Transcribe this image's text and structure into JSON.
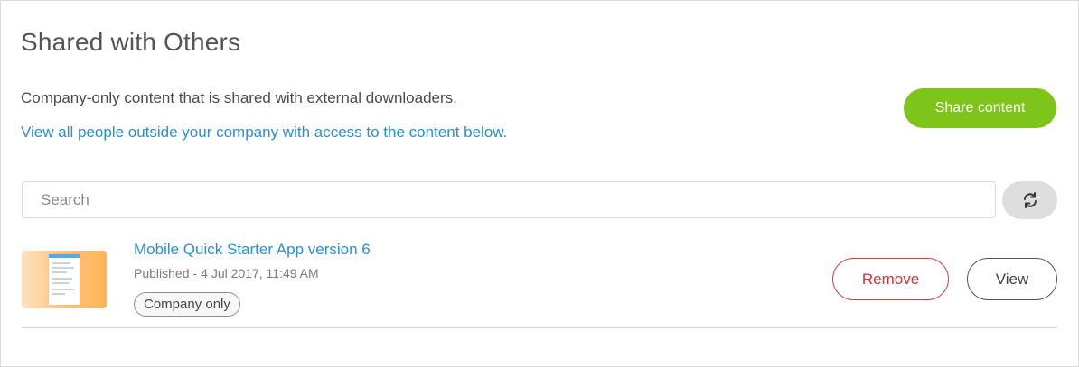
{
  "page": {
    "title": "Shared with Others",
    "description": "Company-only content that is shared with external downloaders.",
    "link_text": "View all people outside your company with access to the content below."
  },
  "actions": {
    "share_label": "Share content",
    "refresh_icon": "refresh-icon"
  },
  "search": {
    "placeholder": "Search",
    "value": ""
  },
  "items": [
    {
      "title": "Mobile Quick Starter App version 6",
      "status": "Published",
      "separator": "-",
      "date": "4 Jul 2017, 11:49 AM",
      "badge": "Company only",
      "remove_label": "Remove",
      "view_label": "View"
    }
  ],
  "colors": {
    "accent_green": "#7dc51a",
    "link_blue": "#2a8fd0",
    "remove_red": "#d23434"
  }
}
